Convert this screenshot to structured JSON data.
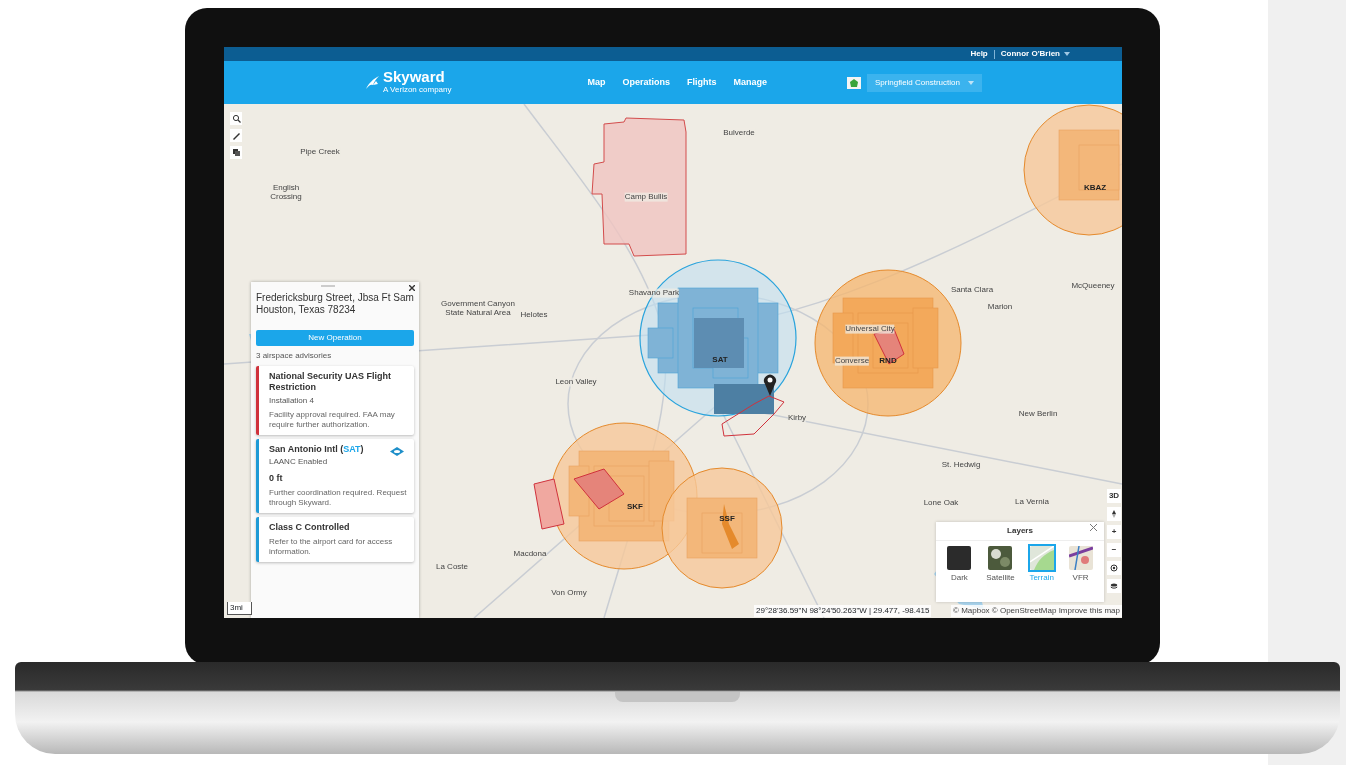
{
  "top_bar": {
    "help": "Help",
    "user": "Connor O'Brien"
  },
  "navbar": {
    "brand": "Skyward",
    "tagline": "A Verizon company",
    "links": [
      "Map",
      "Operations",
      "Flights",
      "Manage"
    ],
    "organization": "Springfield Construction"
  },
  "map": {
    "places": [
      "Pipe Creek",
      "English Crossing",
      "Camp Bullis",
      "Bulverde",
      "Shavano Park",
      "Government Canyon State Natural Area",
      "Helotes",
      "Leon Valley",
      "Kirby",
      "Universal City",
      "Converse",
      "Santa Clara",
      "Marion",
      "McQueeney",
      "New Berlin",
      "St. Hedwig",
      "Lone Oak",
      "La Vernia",
      "Macdona",
      "La Coste",
      "Von Ormy"
    ],
    "airports": [
      "SAT",
      "RND",
      "SKF",
      "SSF",
      "KBAZ"
    ],
    "scale": "3mi",
    "coordinates": "29°28'36.59\"N 98°24'50.263\"W | 29.477, -98.415",
    "attribution": "© Mapbox © OpenStreetMap Improve this map"
  },
  "location_panel": {
    "address": "Fredericksburg Street, Jbsa Ft Sam Houston, Texas 78234",
    "button": "New Operation",
    "summary": "3 airspace advisories",
    "advisories": [
      {
        "title": "National Security UAS Flight Restriction",
        "subtitle": "Installation 4",
        "note": "Facility approval required. FAA may require further authorization.",
        "color": "#d0323c",
        "laanc_icon": false
      },
      {
        "title": "San Antonio Intl (",
        "code": "SAT",
        "title_suffix": ")",
        "subtitle": "LAANC Enabled",
        "altitude": "0 ft",
        "note": "Further coordination required. Request through Skyward.",
        "color": "#1e9ad6",
        "laanc_icon": true
      },
      {
        "title": "Class C Controlled",
        "note": "Refer to the airport card for access information.",
        "color": "#1e9ad6",
        "laanc_icon": false
      }
    ]
  },
  "layers_panel": {
    "title": "Layers",
    "options": [
      {
        "label": "Dark",
        "kind": "dark",
        "selected": false
      },
      {
        "label": "Satellite",
        "kind": "satellite",
        "selected": false
      },
      {
        "label": "Terrain",
        "kind": "terrain",
        "selected": true
      },
      {
        "label": "VFR",
        "kind": "vfr",
        "selected": false
      }
    ]
  },
  "map_controls": [
    "3D",
    "+",
    "−"
  ]
}
